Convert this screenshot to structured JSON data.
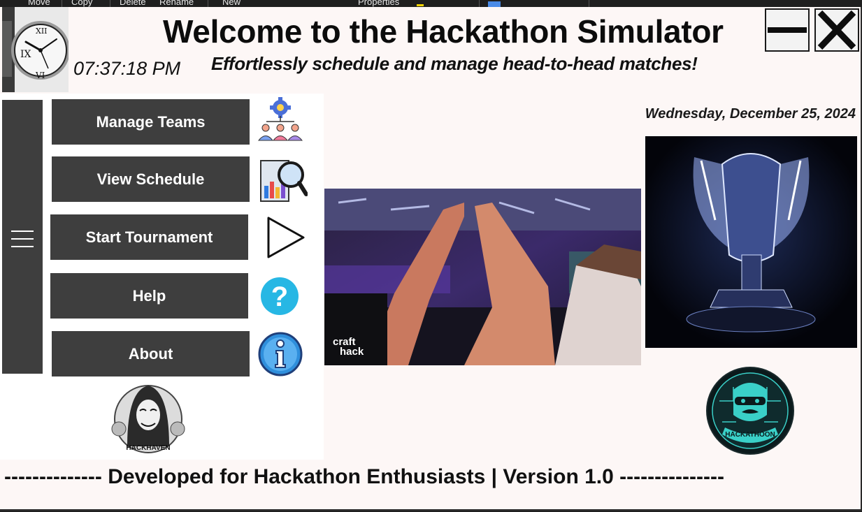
{
  "background_toolbar": {
    "items": [
      "Move",
      "Copy",
      "Delete",
      "Rename",
      "New",
      "Properties"
    ]
  },
  "header": {
    "title": "Welcome to the Hackathon Simulator",
    "subtitle": "Effortlessly schedule and manage head-to-head matches!",
    "time": "07:37:18 PM",
    "clock_icon": "analog-clock-icon"
  },
  "window_controls": {
    "minimize_icon": "minimize-icon",
    "close_icon": "close-icon"
  },
  "sidebar": {
    "toggle_icon": "hamburger-icon",
    "items": [
      {
        "label": "Manage Teams",
        "icon": "team-gear-icon"
      },
      {
        "label": "View Schedule",
        "icon": "chart-magnifier-icon"
      },
      {
        "label": "Start Tournament",
        "icon": "play-icon"
      },
      {
        "label": "Help",
        "icon": "question-icon"
      },
      {
        "label": "About",
        "icon": "info-icon"
      }
    ]
  },
  "main": {
    "date": "Wednesday, December 25, 2024",
    "photo_watermark": "craft hack",
    "left_logo_text": "HACKHAVEN",
    "right_logo_text": "HACKATHOON"
  },
  "footer": {
    "text": "-------------- Developed for Hackathon Enthusiasts | Version 1.0 ---------------"
  },
  "colors": {
    "window_bg": "#fdf7f6",
    "button_bg": "#3e3e3e",
    "button_text": "#ffffff",
    "help_icon": "#27b7e4",
    "info_icon": "#2f8fdc"
  }
}
